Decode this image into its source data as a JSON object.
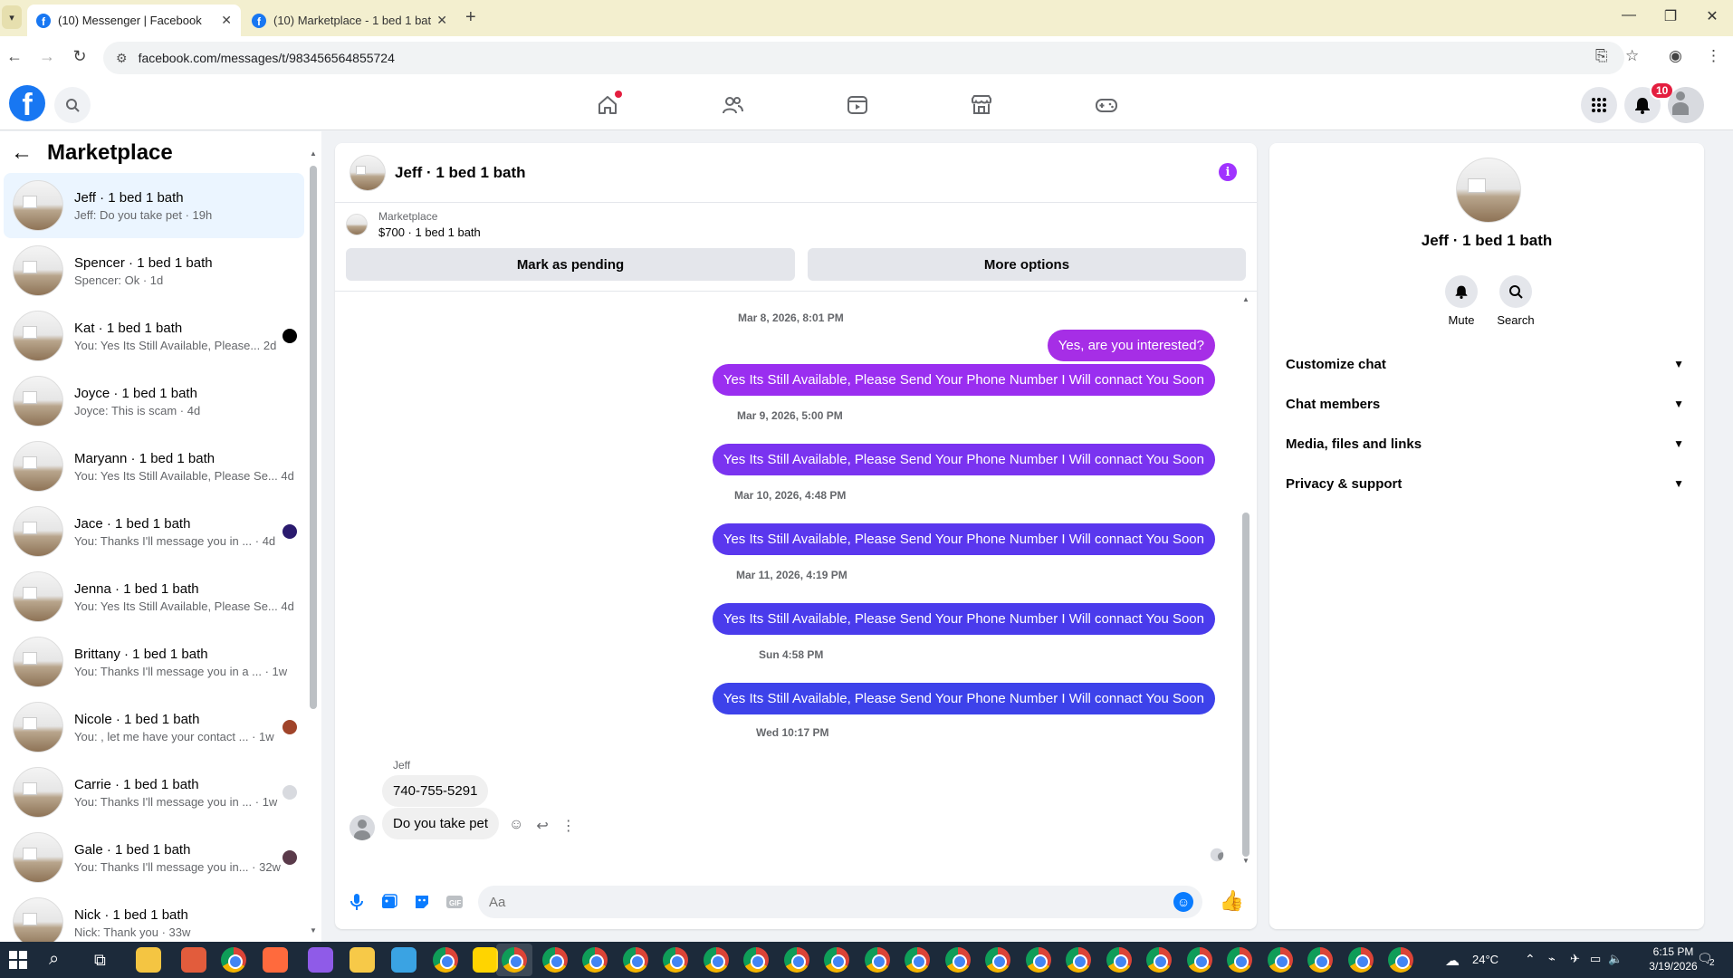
{
  "browser": {
    "tabs": [
      {
        "title": "(10) Messenger | Facebook",
        "active": true
      },
      {
        "title": "(10) Marketplace - 1 bed 1 bath",
        "active": false
      }
    ],
    "url": "facebook.com/messages/t/983456564855724"
  },
  "fb_header": {
    "notifications_count": "10",
    "nav": [
      "home-icon",
      "friends-icon",
      "video-icon",
      "marketplace-icon",
      "gaming-icon"
    ]
  },
  "sidebar": {
    "title": "Marketplace",
    "conversations": [
      {
        "name": "Jeff · 1 bed 1 bath",
        "snippet": "Jeff: Do you take pet · 19h",
        "active": true,
        "badge": ""
      },
      {
        "name": "Spencer · 1 bed 1 bath",
        "snippet": "Spencer: Ok · 1d",
        "active": false,
        "badge": ""
      },
      {
        "name": "Kat · 1 bed 1 bath",
        "snippet": "You: Yes Its Still Available, Please... 2d",
        "active": false,
        "badge": "#000000"
      },
      {
        "name": "Joyce · 1 bed 1 bath",
        "snippet": "Joyce: This is scam · 4d",
        "active": false,
        "badge": ""
      },
      {
        "name": "Maryann · 1 bed 1 bath",
        "snippet": "You: Yes Its Still Available, Please Se... 4d",
        "active": false,
        "badge": ""
      },
      {
        "name": "Jace · 1 bed 1 bath",
        "snippet": "You: Thanks I'll message you in ... · 4d",
        "active": false,
        "badge": "#2a1a6e"
      },
      {
        "name": "Jenna · 1 bed 1 bath",
        "snippet": "You: Yes Its Still Available, Please Se... 4d",
        "active": false,
        "badge": ""
      },
      {
        "name": "Brittany · 1 bed 1 bath",
        "snippet": "You: Thanks I'll message you in a ... · 1w",
        "active": false,
        "badge": ""
      },
      {
        "name": "Nicole · 1 bed 1 bath",
        "snippet": "You: , let me have your contact ... · 1w",
        "active": false,
        "badge": "#a0442a"
      },
      {
        "name": "Carrie · 1 bed 1 bath",
        "snippet": "You: Thanks I'll message you in ... · 1w",
        "active": false,
        "badge": "#d8dadf"
      },
      {
        "name": "Gale · 1 bed 1 bath",
        "snippet": "You: Thanks I'll message you in... · 32w",
        "active": false,
        "badge": "#5a3a4a"
      },
      {
        "name": "Nick · 1 bed 1 bath",
        "snippet": "Nick: Thank you · 33w",
        "active": false,
        "badge": ""
      }
    ]
  },
  "chat": {
    "header_name": "Jeff · 1 bed 1 bath",
    "listing_source": "Marketplace",
    "listing_title": "$700 · 1 bed 1 bath",
    "mark_pending_label": "Mark as pending",
    "more_options_label": "More options",
    "timestamps": [
      "Mar 8, 2026, 8:01 PM",
      "Mar 9, 2026, 5:00 PM",
      "Mar 10, 2026, 4:48 PM",
      "Mar 11, 2026, 4:19 PM",
      "Sun 4:58 PM",
      "Wed 10:17 PM"
    ],
    "outgoing": [
      {
        "text": "Yes, are you interested?",
        "color": "#a62ee6"
      },
      {
        "text": "Yes Its Still Available, Please Send Your Phone Number I Will connact You Soon",
        "color": "#9a2ef0"
      },
      {
        "text": "Yes Its Still Available, Please Send Your Phone Number I Will connact You Soon",
        "color": "#7a33f0"
      },
      {
        "text": "Yes Its Still Available, Please Send Your Phone Number I Will connact You Soon",
        "color": "#5a37ee"
      },
      {
        "text": "Yes Its Still Available, Please Send Your Phone Number I Will connact You Soon",
        "color": "#4a3bec"
      },
      {
        "text": "Yes Its Still Available, Please Send Your Phone Number I Will connact You Soon",
        "color": "#3d42ea"
      }
    ],
    "incoming_sender": "Jeff",
    "incoming": [
      "740-755-5291",
      "Do you take pet"
    ],
    "composer_placeholder": "Aa"
  },
  "details": {
    "name": "Jeff · 1 bed 1 bath",
    "mute_label": "Mute",
    "search_label": "Search",
    "sections": [
      "Customize chat",
      "Chat members",
      "Media, files and links",
      "Privacy & support"
    ]
  },
  "taskbar": {
    "weather": "24°C",
    "time": "6:15 PM",
    "date": "3/19/2026",
    "notification_count": "2"
  }
}
